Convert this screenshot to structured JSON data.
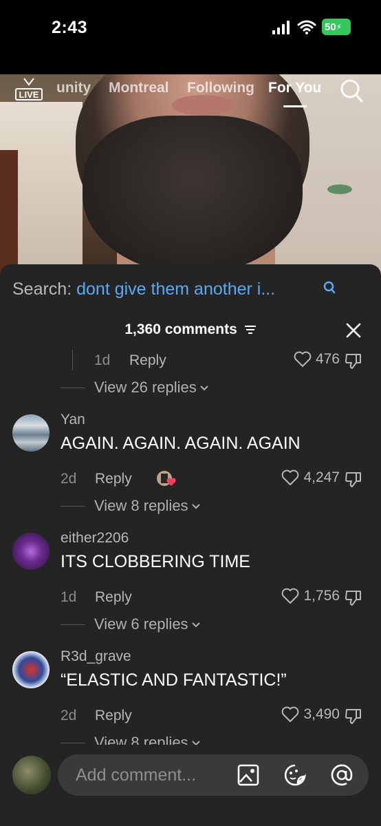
{
  "status_bar": {
    "time": "2:43",
    "battery": "50"
  },
  "top_nav": {
    "live_label": "LIVE",
    "tabs": [
      {
        "label": "unity"
      },
      {
        "label": "Montreal"
      },
      {
        "label": "Following"
      },
      {
        "label": "For You"
      }
    ]
  },
  "search": {
    "label": "Search: ",
    "query": "dont give them another i..."
  },
  "comments_header": {
    "title": "1,360 comments"
  },
  "top_partial": {
    "time": "1d",
    "reply": "Reply",
    "likes": "476",
    "view_replies": "View 26 replies"
  },
  "comments": [
    {
      "username": "Yan",
      "text": "AGAIN. AGAIN. AGAIN. AGAIN",
      "time": "2d",
      "reply": "Reply",
      "likes": "4,247",
      "view_replies": "View 8 replies"
    },
    {
      "username": "either2206",
      "text": "ITS CLOBBERING TIME",
      "time": "1d",
      "reply": "Reply",
      "likes": "1,756",
      "view_replies": "View 6 replies"
    },
    {
      "username": "R3d_grave",
      "text": "“ELASTIC AND FANTASTIC!”",
      "time": "2d",
      "reply": "Reply",
      "likes": "3,490",
      "view_replies": "View 8 replies"
    }
  ],
  "bottom_bar": {
    "placeholder": "Add comment..."
  },
  "colors": {
    "accent_link": "#5aa9f5",
    "panel_bg": "#242424",
    "battery": "#34c759"
  }
}
